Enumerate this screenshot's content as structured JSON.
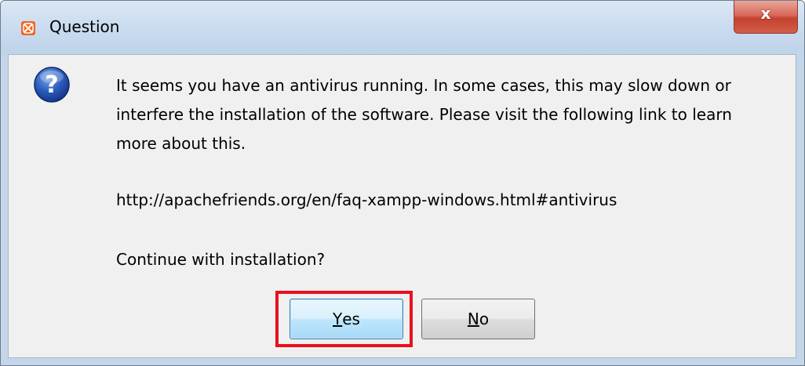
{
  "window": {
    "title": "Question",
    "close_label": "x"
  },
  "dialog": {
    "icon": "question-icon",
    "message": "It seems you have an antivirus running. In some cases, this may slow down or interfere the installation of the software. Please visit the following link to learn more about this.",
    "url": "http://apachefriends.org/en/faq-xampp-windows.html#antivirus",
    "prompt": "Continue with installation?"
  },
  "buttons": {
    "yes_mnemonic": "Y",
    "yes_rest": "es",
    "no_mnemonic": "N",
    "no_rest": "o"
  },
  "colors": {
    "highlight": "#e8101c",
    "app_icon": "#f26522"
  }
}
